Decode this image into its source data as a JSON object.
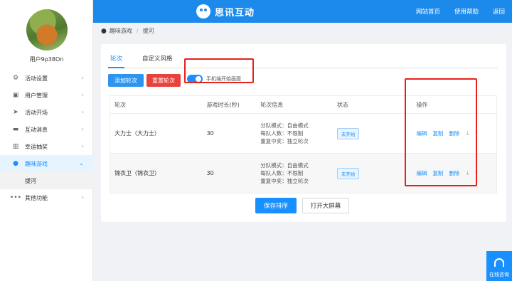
{
  "header": {
    "brand": "思讯互动",
    "nav": [
      "网站首页",
      "使用帮助",
      "返回"
    ]
  },
  "user": {
    "name": "用户9p38On"
  },
  "sidebar": {
    "items": [
      {
        "label": "活动设置",
        "icon": "gear-icon"
      },
      {
        "label": "用户管理",
        "icon": "user-icon"
      },
      {
        "label": "活动开场",
        "icon": "send-icon"
      },
      {
        "label": "互动消息",
        "icon": "message-icon"
      },
      {
        "label": "幸运抽奖",
        "icon": "lottery-icon"
      },
      {
        "label": "趣味游戏",
        "icon": "game-icon",
        "active": true
      },
      {
        "label": "其他功能",
        "icon": "more-icon"
      }
    ],
    "submenu": [
      {
        "label": "拔河"
      }
    ]
  },
  "breadcrumb": {
    "parent": "趣味游戏",
    "sep": "/",
    "current": "拔河"
  },
  "tabs": [
    "轮次",
    "自定义风格"
  ],
  "toolbar": {
    "add_label": "添加轮次",
    "reset_label": "重置轮次",
    "toggle_label": "手机端开始画面",
    "toggle_on": true
  },
  "table": {
    "headers": [
      "轮次",
      "游戏时长(秒)",
      "轮次信息",
      "状态",
      "操作"
    ],
    "rows": [
      {
        "name": "大力士（大力士）",
        "duration": "30",
        "info": [
          "分队模式：自由模式",
          "每队人数：不限制",
          "重复中奖：独立轮次"
        ],
        "status": "未开始",
        "ops": [
          "编辑",
          "复制",
          "删除",
          "↓",
          "↑"
        ]
      },
      {
        "name": "锦衣卫（锦衣卫）",
        "duration": "30",
        "info": [
          "分队模式：自由模式",
          "每队人数：不限制",
          "重复中奖：独立轮次"
        ],
        "status": "未开始",
        "ops": [
          "编辑",
          "复制",
          "删除",
          "↓",
          "↑"
        ]
      }
    ]
  },
  "footer": {
    "save_label": "保存排序",
    "screen_label": "打开大屏幕"
  },
  "service": {
    "label": "在线咨询"
  },
  "colors": {
    "primary": "#1890ff",
    "header": "#1c8aeb",
    "danger": "#e8423c",
    "highlight": "#e8201a"
  }
}
